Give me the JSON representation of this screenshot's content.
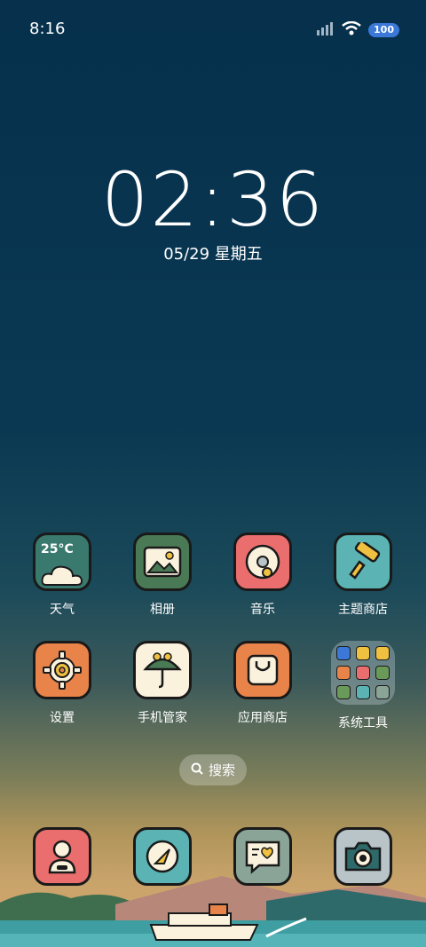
{
  "status_bar": {
    "time": "8:16",
    "battery": "100"
  },
  "clock": {
    "time": "02:36",
    "date": "05/29 星期五"
  },
  "apps_row1": [
    {
      "label": "天气",
      "icon": "weather-icon",
      "color": "#3a7a6e",
      "temp": "25°C"
    },
    {
      "label": "相册",
      "icon": "photo-icon",
      "color": "#4a7a55"
    },
    {
      "label": "音乐",
      "icon": "music-disc-icon",
      "color": "#ea6e6e"
    },
    {
      "label": "主题商店",
      "icon": "paint-roller-icon",
      "color": "#5bb3b3"
    }
  ],
  "apps_row2": [
    {
      "label": "设置",
      "icon": "gear-icon",
      "color": "#e8844a"
    },
    {
      "label": "手机管家",
      "icon": "umbrella-icon",
      "color": "#fbf2de"
    },
    {
      "label": "应用商店",
      "icon": "shopping-bag-icon",
      "color": "#e8844a"
    },
    {
      "label": "系统工具",
      "icon": "folder-icon",
      "color": "#c9d7dc"
    }
  ],
  "search": {
    "label": "搜索"
  },
  "dock": [
    {
      "icon": "contacts-icon",
      "color": "#ea6e6e"
    },
    {
      "icon": "browser-compass-icon",
      "color": "#5bb3b3"
    },
    {
      "icon": "message-heart-icon",
      "color": "#8aa597"
    },
    {
      "icon": "camera-icon",
      "color": "#b8c4c8"
    }
  ],
  "colors": {
    "accent_battery": "#3b78d8",
    "sky_top": "#06304c",
    "sky_bottom": "#d7a86f"
  }
}
